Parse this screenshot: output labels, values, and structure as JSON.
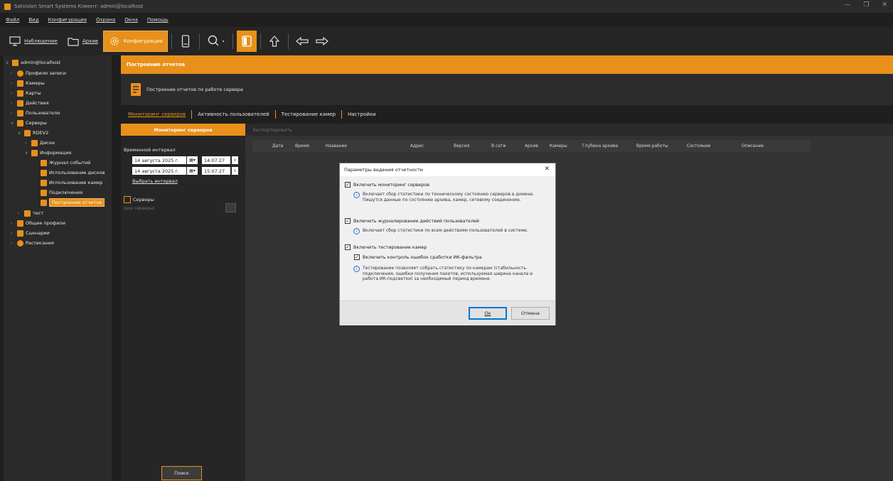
{
  "window": {
    "title": "Satvision Smart Systems Клиент: admin@localhost",
    "controls": [
      "—",
      "❐",
      "✕"
    ]
  },
  "menu": [
    "Файл",
    "Вид",
    "Конфигурация",
    "Охрана",
    "Окна",
    "Помощь"
  ],
  "toolbar": {
    "monitoring": "Наблюдение",
    "archive": "Архив",
    "configuration": "Конфигурация"
  },
  "tree": {
    "root": "admin@localhost",
    "items": [
      "Профили записи",
      "Камеры",
      "Карты",
      "Действия",
      "Пользователи",
      "Серверы",
      "RDEV2",
      "Диски",
      "Информация",
      "Журнал событий",
      "Использование дисков",
      "Использование камер",
      "Подключения",
      "Построение отчетов",
      "тест",
      "Общие профили",
      "Сценарии",
      "Расписания"
    ]
  },
  "header": {
    "title": "Построение отчетов",
    "subtitle": "Построение отчетов по работе сервера"
  },
  "tabs": [
    "Мониторинг серверов",
    "Активность пользователей",
    "Тестирование камер",
    "Настройки"
  ],
  "left": {
    "monitor_button": "Мониторинг серверов",
    "interval_label": "Временной интервал",
    "date1": "14  августа  2025 г.",
    "time1": "14:07:27",
    "date2": "14  августа  2025 г.",
    "time2": "15:07:27",
    "choose_interval": "Выбрать интервал",
    "servers_label": "Серверы",
    "servers_value": "(все серверы)",
    "search": "Поиск"
  },
  "right": {
    "export": "Экспортировать",
    "columns": [
      "Дата",
      "Время",
      "Название",
      "Адрес",
      "Версия",
      "В сети",
      "Архив",
      "Камеры",
      "Глубина архива",
      "Время работы",
      "Состояние",
      "Описание"
    ]
  },
  "dialog": {
    "title": "Параметры ведения отчетности",
    "opt1": "Включить мониторинг серверов",
    "opt1_info": "Включает сбор статистики по техническому состоянию серверов в домене. Пишутся данные по состоянию архива, камер, сетевому соединению.",
    "opt2": "Включить журналирование действий пользователей",
    "opt2_info": "Включает сбор статистики по всем действиям пользователей в системе.",
    "opt3": "Включить тестирование камер",
    "opt3_sub": "Включить контроль ошибок сработки ИК-фильтра",
    "opt3_info": "Тестирование позволяет собрать статистику по камерам (стабильность подключения, ошибки получения пакетов, используемая ширина канала и работа ИК-подсветки) за необходимый период времени.",
    "ok": "Ок",
    "cancel": "Отмена"
  },
  "colors": {
    "accent": "#e8901a",
    "bg": "#1e1e1e"
  }
}
